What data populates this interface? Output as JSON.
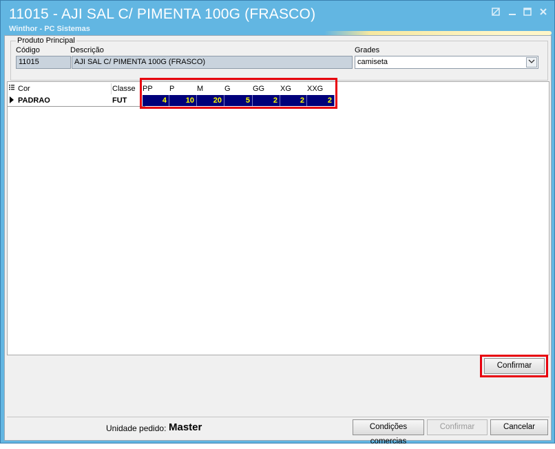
{
  "window": {
    "title": "11015 - AJI SAL C/ PIMENTA 100G (FRASCO)",
    "subtitle": "Winthor - PC Sistemas",
    "controls": [
      "restore-icon",
      "minimize-icon",
      "maximize-icon",
      "close-icon"
    ]
  },
  "produto": {
    "group_label": "Produto Principal",
    "codigo_label": "Código",
    "codigo_value": "11015",
    "descricao_label": "Descrição",
    "descricao_value": "AJI SAL C/ PIMENTA 100G (FRASCO)",
    "grades_label": "Grades",
    "grades_value": "camiseta"
  },
  "grid": {
    "columns": [
      "Cor",
      "Classe",
      "PP",
      "P",
      "M",
      "G",
      "GG",
      "XG",
      "XXG"
    ],
    "rows": [
      {
        "cor": "PADRAO",
        "classe": "FUT",
        "sizes": [
          "4",
          "10",
          "20",
          "5",
          "2",
          "2",
          "2"
        ]
      }
    ]
  },
  "buttons": {
    "confirmar_top": "Confirmar",
    "condicoes": "Condições comercias",
    "confirmar_bottom": "Confirmar",
    "cancelar": "Cancelar"
  },
  "footer": {
    "unidade_label": "Unidade pedido:",
    "unidade_value": "Master"
  },
  "colors": {
    "title_bar": "#62b6e2",
    "highlight": "#e8000d",
    "size_cell_bg": "#00007a",
    "size_cell_text": "#ffff00"
  }
}
